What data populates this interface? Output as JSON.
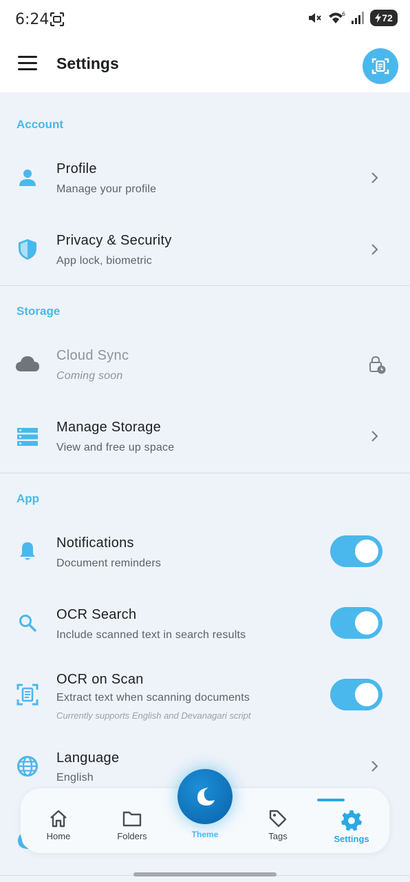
{
  "status_bar": {
    "time": "6:24",
    "battery": "72",
    "network_badge": "6"
  },
  "app_bar": {
    "title": "Settings",
    "menu_icon": "hamburger-menu-icon",
    "action_icon": "document-scan-icon"
  },
  "sections": [
    {
      "header": "Account",
      "items": [
        {
          "title": "Profile",
          "subtitle": "Manage your profile",
          "icon": "person-icon",
          "control": "chevron"
        },
        {
          "title": "Privacy & Security",
          "subtitle": "App lock, biometric",
          "icon": "shield-icon",
          "control": "chevron"
        }
      ]
    },
    {
      "header": "Storage",
      "items": [
        {
          "title": "Cloud Sync",
          "subtitle": "Coming soon",
          "icon": "cloud-icon",
          "control": "lock",
          "disabled": true
        },
        {
          "title": "Manage Storage",
          "subtitle": "View and free up space",
          "icon": "storage-icon",
          "control": "chevron"
        }
      ]
    },
    {
      "header": "App",
      "items": [
        {
          "title": "Notifications",
          "subtitle": "Document reminders",
          "icon": "bell-icon",
          "control": "toggle",
          "value": true
        },
        {
          "title": "OCR Search",
          "subtitle": "Include scanned text in search results",
          "icon": "search-icon",
          "control": "toggle",
          "value": true
        },
        {
          "title": "OCR on Scan",
          "subtitle": "Extract text when scanning documents",
          "note": "Currently supports English and Devanagari script",
          "icon": "document-scan-icon",
          "control": "toggle",
          "value": true
        },
        {
          "title": "Language",
          "subtitle": "English",
          "icon": "globe-icon",
          "control": "chevron"
        }
      ]
    }
  ],
  "bottom_nav": {
    "items": [
      {
        "label": "Home",
        "icon": "home-icon",
        "active": false
      },
      {
        "label": "Folders",
        "icon": "folder-icon",
        "active": false
      },
      {
        "label": "Theme",
        "icon": "moon-icon",
        "active": false
      },
      {
        "label": "Tags",
        "icon": "tag-icon",
        "active": false
      },
      {
        "label": "Settings",
        "icon": "gear-icon",
        "active": true
      }
    ]
  },
  "colors": {
    "accent": "#4ab8ec",
    "accent_dark": "#0a62ab",
    "background": "#eef3f9",
    "text": "#1d1f23",
    "muted": "#5d6167"
  }
}
